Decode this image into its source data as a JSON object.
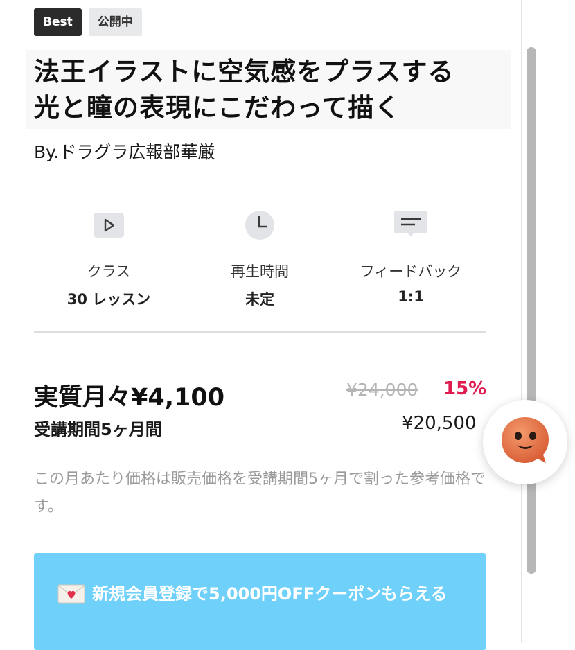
{
  "badges": {
    "best": "Best",
    "public": "公開中"
  },
  "course": {
    "title_line1": "法王イラストに空気感をプラスする",
    "title_line2": "光と瞳の表現にこだわって描く",
    "author": "By.ドラグラ広報部華厳"
  },
  "stats": [
    {
      "icon": "play-icon",
      "label": "クラス",
      "value": "30 レッスン"
    },
    {
      "icon": "clock-icon",
      "label": "再生時間",
      "value": "未定"
    },
    {
      "icon": "feedback-icon",
      "label": "フィードバック",
      "value": "1:1"
    }
  ],
  "pricing": {
    "monthly": "実質月々¥4,100",
    "period": "受講期間5ヶ月間",
    "original": "¥24,000",
    "discount": "15%",
    "sale": "¥20,500",
    "note": "この月あたり価格は販売価格を受講期間5ヶ月で割った参考価格です。"
  },
  "promo": {
    "icon": "love-letter-icon",
    "text": "新規会員登録で5,000円OFFクーポンもらえる"
  },
  "colors": {
    "accent_red": "#e01b50",
    "banner": "#6fd0fa",
    "chat_face": "#e8744a"
  }
}
